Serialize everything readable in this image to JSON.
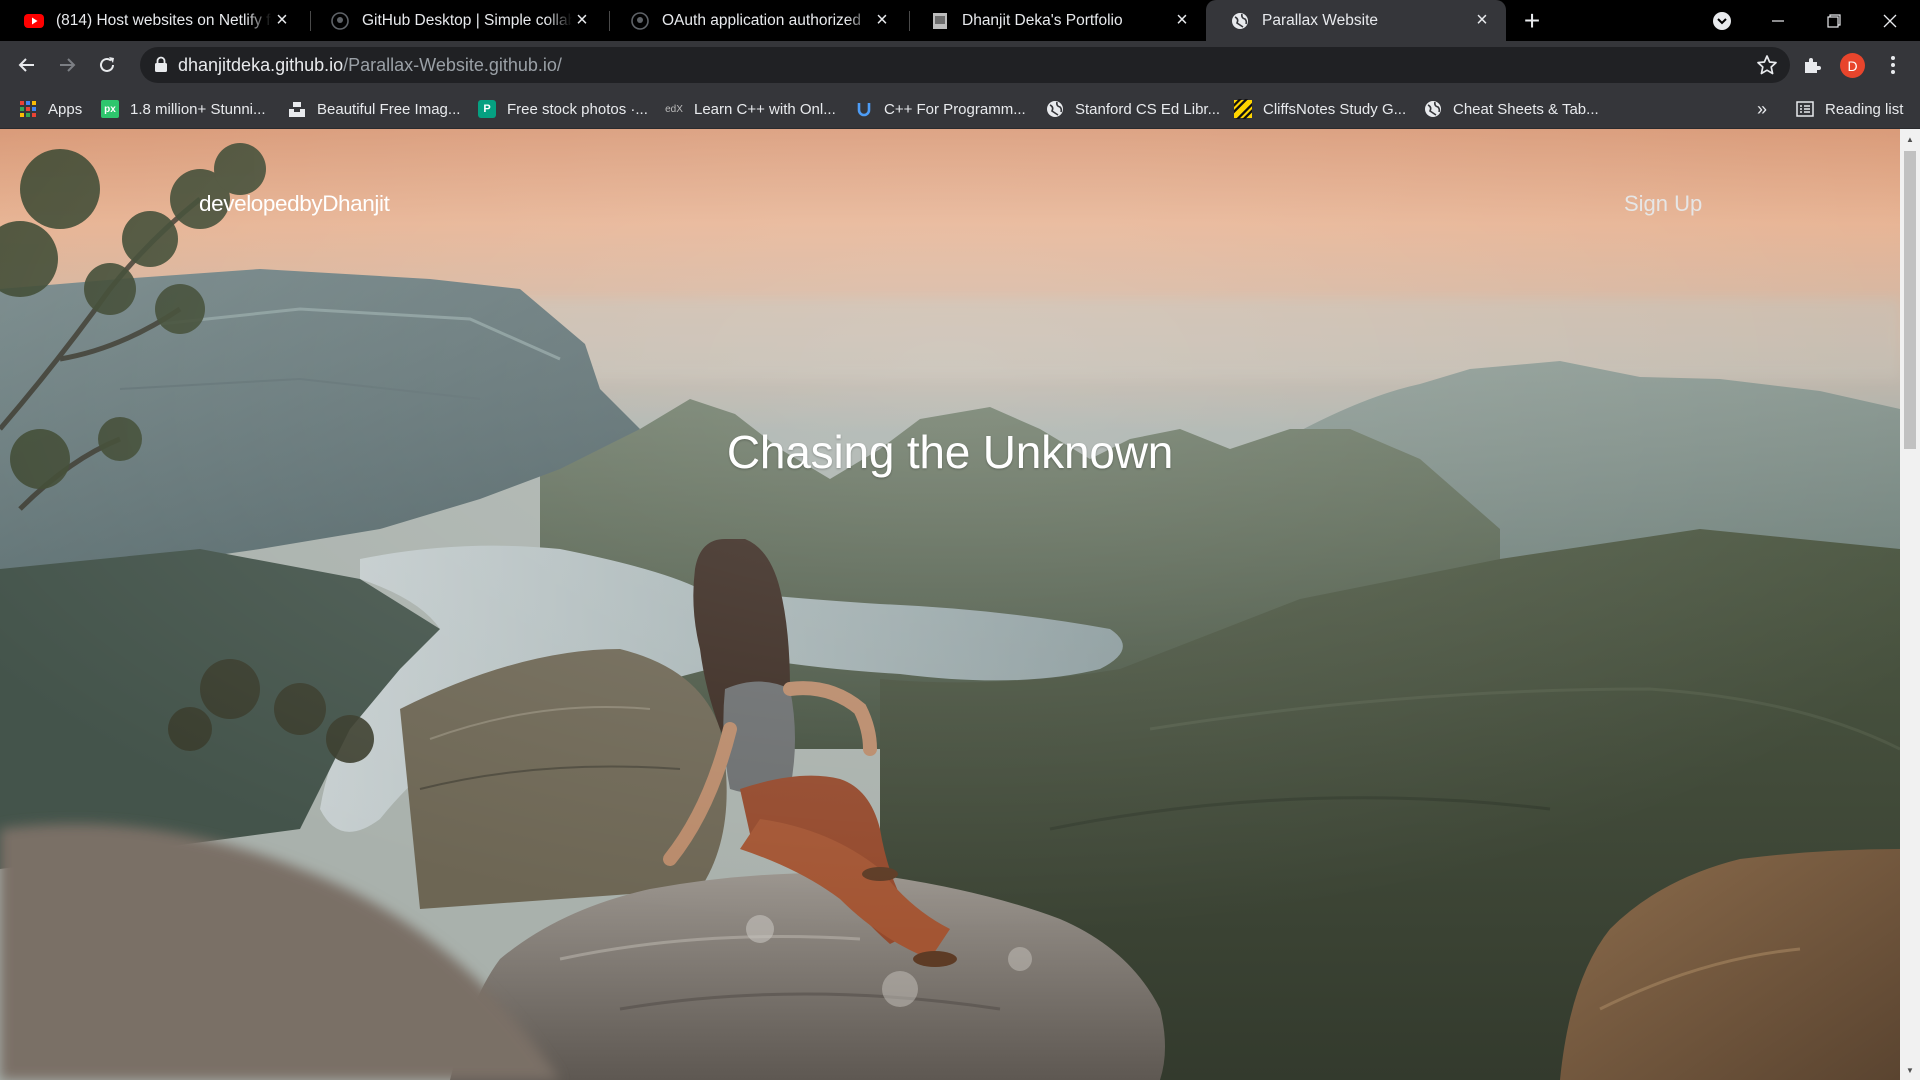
{
  "browser": {
    "tabs": [
      {
        "title": "(814) Host websites on Netlify fo",
        "favicon": "youtube-icon",
        "active": false
      },
      {
        "title": "GitHub Desktop | Simple collabor",
        "favicon": "github-icon",
        "active": false
      },
      {
        "title": "OAuth application authorized",
        "favicon": "github-icon",
        "active": false
      },
      {
        "title": "Dhanjit Deka's Portfolio",
        "favicon": "portfolio-icon",
        "active": false
      },
      {
        "title": "Parallax Website",
        "favicon": "globe-icon",
        "active": true
      }
    ],
    "address": {
      "host": "dhanjitdeka.github.io",
      "path": "/Parallax-Website.github.io/"
    },
    "profile_initial": "D",
    "bookmarks": [
      {
        "label": "Apps",
        "icon": "apps-grid-icon"
      },
      {
        "label": "1.8 million+ Stunni...",
        "icon": "pixabay-icon"
      },
      {
        "label": "Beautiful Free Imag...",
        "icon": "unsplash-icon"
      },
      {
        "label": "Free stock photos ·...",
        "icon": "pexels-icon"
      },
      {
        "label": "Learn C++ with Onl...",
        "icon": "edx-icon"
      },
      {
        "label": "C++ For Programm...",
        "icon": "udemy-icon"
      },
      {
        "label": "Stanford CS Ed Libr...",
        "icon": "globe-icon"
      },
      {
        "label": "CliffsNotes Study G...",
        "icon": "cliffsnotes-icon"
      },
      {
        "label": "Cheat Sheets & Tab...",
        "icon": "globe-icon"
      }
    ],
    "reading_list_label": "Reading list",
    "overflow_label": "»",
    "colors": {
      "profile": "#e8452c",
      "active_tab": "#35363a",
      "tab_strip": "#000000"
    }
  },
  "page": {
    "brand": "developedbyDhanjit",
    "nav_signup": "Sign Up",
    "headline": "Chasing the Unknown"
  }
}
